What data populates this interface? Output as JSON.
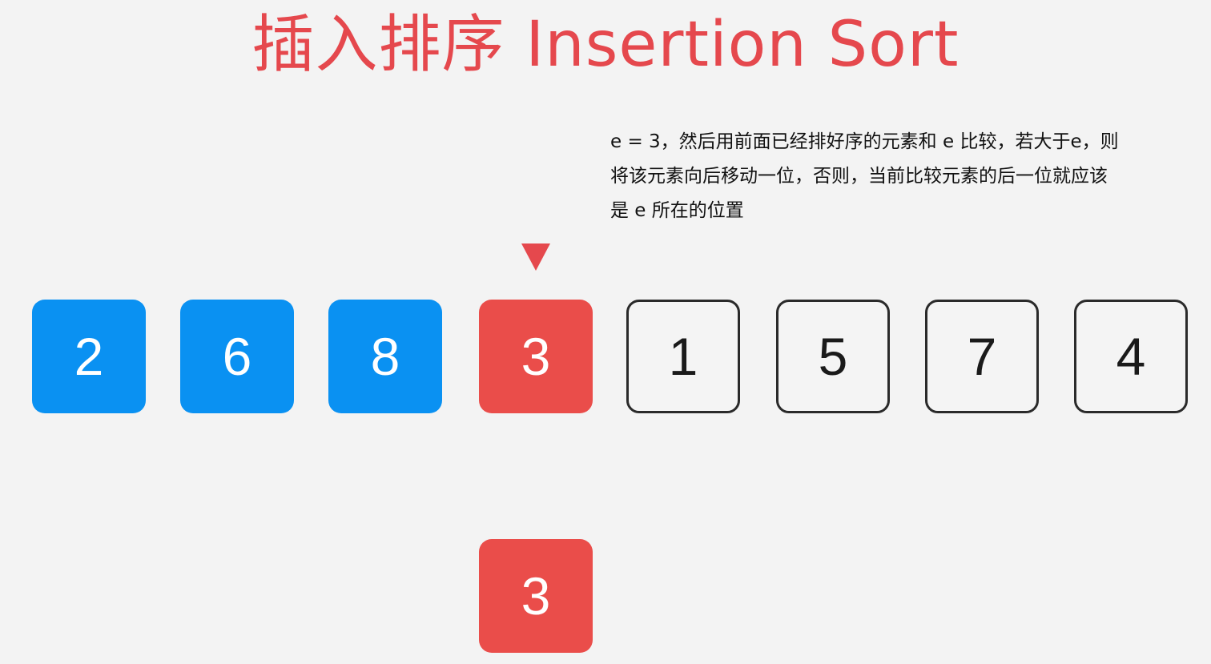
{
  "title": "插入排序 Insertion Sort",
  "description": {
    "lines": [
      "e = 3，然后用前面已经排好序的元素和 e 比较，若大于e，则",
      "将该元素向后移动一位，否则，当前比较元素的后一位就应该",
      "是 e 所在的位置"
    ]
  },
  "array": {
    "items": [
      {
        "value": "2",
        "state": "sorted"
      },
      {
        "value": "6",
        "state": "sorted"
      },
      {
        "value": "8",
        "state": "sorted"
      },
      {
        "value": "3",
        "state": "current"
      },
      {
        "value": "1",
        "state": "unsorted"
      },
      {
        "value": "5",
        "state": "unsorted"
      },
      {
        "value": "7",
        "state": "unsorted"
      },
      {
        "value": "4",
        "state": "unsorted"
      }
    ],
    "pointer_index": 3
  },
  "held_element": {
    "value": "3"
  },
  "colors": {
    "title": "#e5484d",
    "sorted": "#0a91f2",
    "current": "#ea4d4a",
    "unsorted_border": "#2a2a2a",
    "background": "#f3f3f3"
  }
}
